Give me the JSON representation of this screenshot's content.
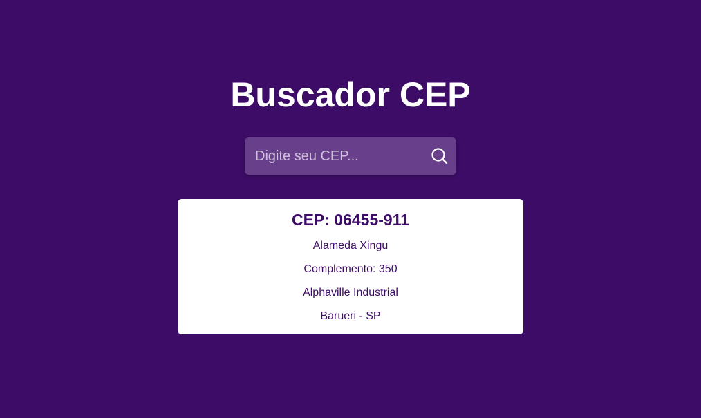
{
  "page": {
    "title": "Buscador CEP"
  },
  "search": {
    "placeholder": "Digite seu CEP...",
    "value": "",
    "button_icon": "search-icon"
  },
  "result": {
    "cep_heading": "CEP: 06455-911",
    "logradouro": "Alameda Xingu",
    "complemento": "Complemento: 350",
    "bairro": "Alphaville Industrial",
    "cidade_uf": "Barueri - SP"
  },
  "colors": {
    "background": "#3d0c67",
    "search_background": "#673f8a",
    "card_background": "#ffffff",
    "card_text": "#3d0c67",
    "title_text": "#ffffff"
  }
}
